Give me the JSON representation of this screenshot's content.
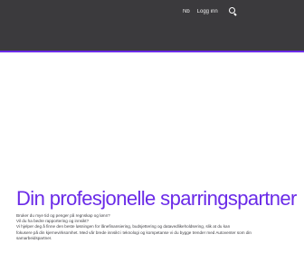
{
  "colors": {
    "topbar": "#3b3a3d",
    "accent": "#6b2be8",
    "text": "#3f3f44"
  },
  "nav": {
    "items": [
      {
        "label": "Nb"
      },
      {
        "label": "Logg inn"
      }
    ],
    "search_icon": "search-icon"
  },
  "hero": {
    "title": "Din profesjonelle sparringspartner",
    "lines": [
      "Bruker du mye tid og penger på regnskap og lønn?",
      "Vil du ha bedre rapportering og innsikt?",
      "Vi hjelper deg å finne den beste løsningen for lånefinansiering, budsjettering og datavedlikeholdsering, slik at du kan",
      "fokusere på din kjernevirksomhet. Med vår brede innsikt i teknologi og kompetanse vi du bygge trender med Autoventer som din",
      "samarbeidspartner."
    ]
  }
}
